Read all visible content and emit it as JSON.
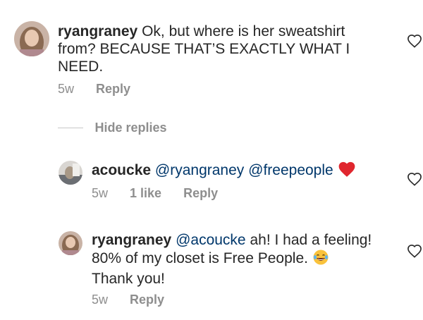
{
  "comments": [
    {
      "username": "ryangraney",
      "text_line1": "Ok, but where is her sweatshirt",
      "text_line2": "from? BECAUSE THAT’S EXACTLY WHAT I",
      "text_line3": "NEED.",
      "age": "5w",
      "reply_label": "Reply"
    }
  ],
  "thread": {
    "hide_replies_label": "Hide replies"
  },
  "replies": [
    {
      "username": "acoucke",
      "mention1": "@ryangraney",
      "mention2": "@freepeople",
      "emoji": "red-heart",
      "age": "5w",
      "likes": "1 like",
      "reply_label": "Reply"
    },
    {
      "username": "ryangraney",
      "mention": "@acoucke",
      "text_line1": "ah! I had a feeling!",
      "text_line2": "80% of my closet is Free People.",
      "emoji": "tears-of-joy",
      "text_line3": "Thank you!",
      "age": "5w",
      "reply_label": "Reply"
    }
  ],
  "colors": {
    "text": "#262626",
    "meta": "#8e8e8e",
    "mention": "#00376b",
    "heart_emoji": "#e0262e",
    "emoji_face": "#f9c23c"
  },
  "icons": {
    "like": "heart-outline-icon",
    "reaction_heart": "red-heart-emoji",
    "reaction_laugh": "tears-of-joy-emoji"
  }
}
